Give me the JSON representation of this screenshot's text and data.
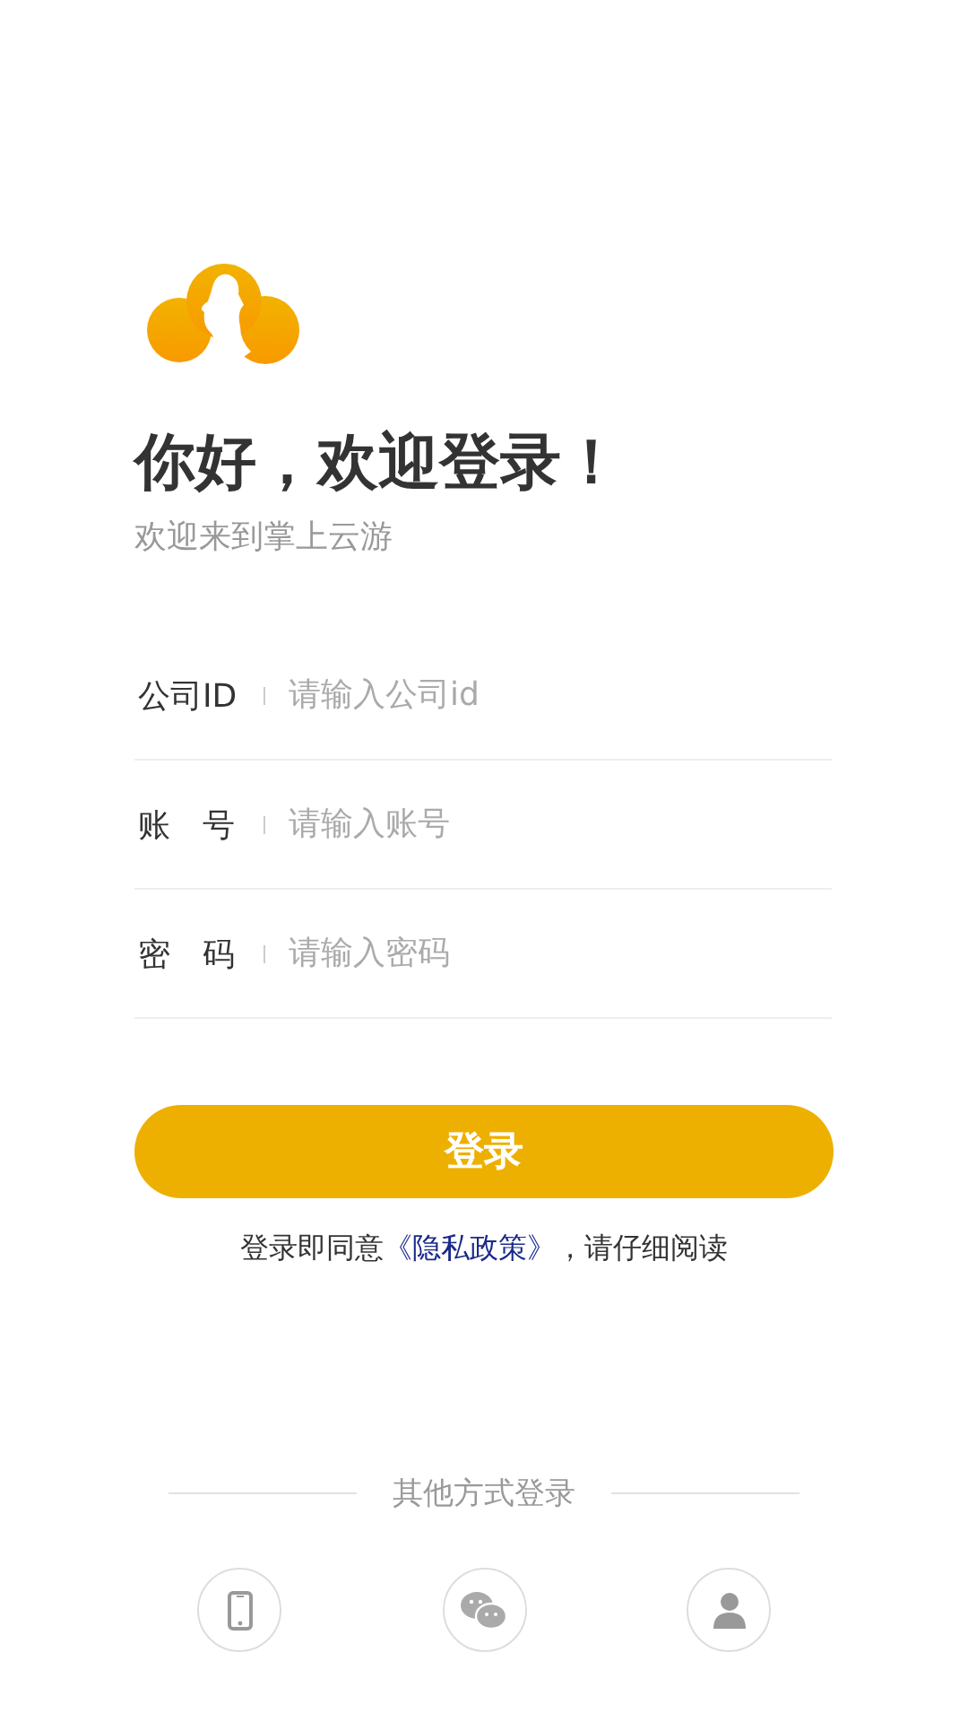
{
  "header": {
    "title": "你好，欢迎登录！",
    "subtitle": "欢迎来到掌上云游"
  },
  "fields": [
    {
      "label": "公司ID",
      "placeholder": "请输入公司id"
    },
    {
      "label": "账　号",
      "placeholder": "请输入账号"
    },
    {
      "label": "密　码",
      "placeholder": "请输入密码"
    }
  ],
  "login_button": "登录",
  "agreement": {
    "before": "登录即同意",
    "link": "《隐私政策》",
    "after": "，请仔细阅读"
  },
  "other_login": {
    "title": "其他方式登录",
    "methods": [
      {
        "kind": "phone"
      },
      {
        "kind": "wechat"
      },
      {
        "kind": "user"
      }
    ]
  }
}
